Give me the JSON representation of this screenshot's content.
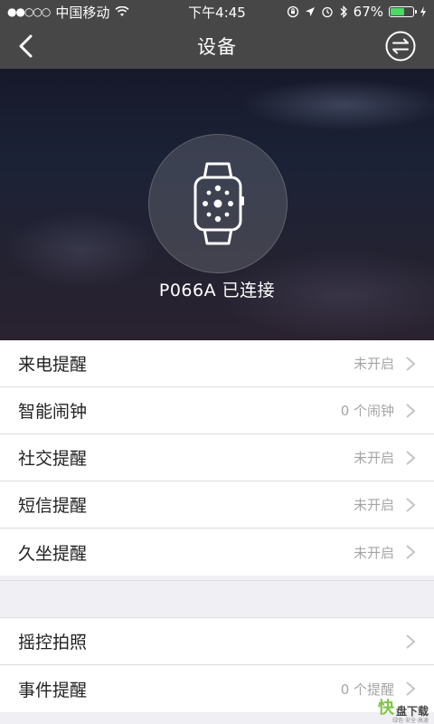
{
  "status_bar": {
    "signal": "●●○○○",
    "carrier": "中国移动",
    "time": "下午4:45",
    "battery_percent": "67%",
    "battery_level": 0.67
  },
  "nav": {
    "title": "设备"
  },
  "hero": {
    "device_status": "P066A 已连接"
  },
  "settings_group1": [
    {
      "label": "来电提醒",
      "value": "未开启"
    },
    {
      "label": "智能闹钟",
      "value": "0 个闹钟"
    },
    {
      "label": "社交提醒",
      "value": "未开启"
    },
    {
      "label": "短信提醒",
      "value": "未开启"
    },
    {
      "label": "久坐提醒",
      "value": "未开启"
    }
  ],
  "settings_group2": [
    {
      "label": "摇控拍照",
      "value": ""
    },
    {
      "label": "事件提醒",
      "value": "0 个提醒"
    }
  ],
  "watermark": {
    "mark": "快",
    "text": "盘下载",
    "sub": "绿色·安全·高速"
  },
  "colors": {
    "navbar": "#474747",
    "background": "#efeff4",
    "battery_green": "#4cd964"
  }
}
